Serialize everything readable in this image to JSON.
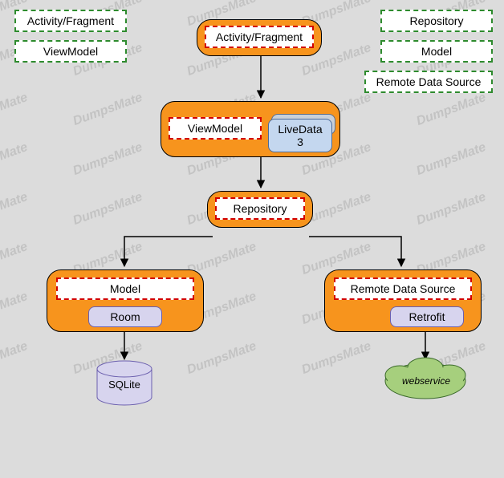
{
  "watermark": "DumpsMate",
  "options": {
    "opt1": "Activity/Fragment",
    "opt2": "ViewModel",
    "opt3": "Repository",
    "opt4": "Model",
    "opt5": "Remote Data Source"
  },
  "diagram": {
    "top_slot": "Activity/Fragment",
    "vm_slot": "ViewModel",
    "livedata": "LiveData 3",
    "repo_slot": "Repository",
    "model_slot": "Model",
    "room": "Room",
    "sqlite": "SQLite",
    "remote_slot": "Remote Data Source",
    "retrofit": "Retrofit",
    "webservice": "webservice"
  }
}
